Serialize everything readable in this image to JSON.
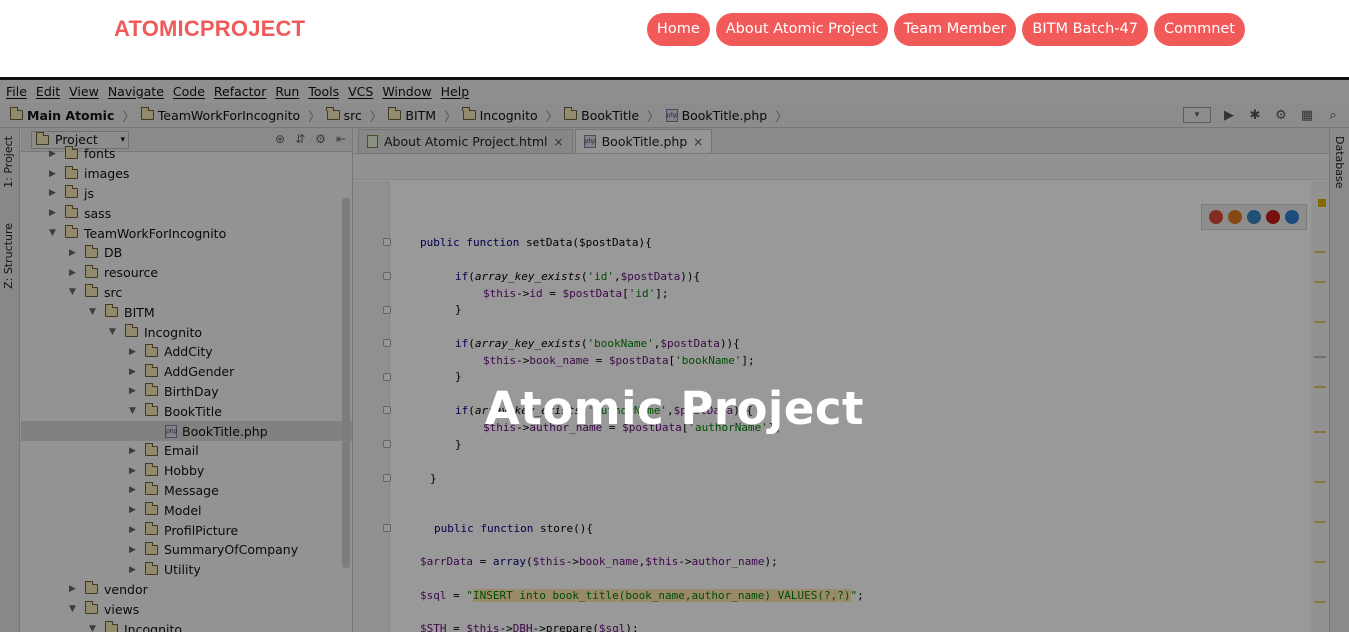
{
  "site": {
    "brand": "ATOMICPROJECT",
    "nav": [
      "Home",
      "About Atomic Project",
      "Team Member",
      "BITM Batch-47",
      "Commnet"
    ],
    "hero_title": "Atomic Project"
  },
  "ide": {
    "menu": [
      "File",
      "Edit",
      "View",
      "Navigate",
      "Code",
      "Refactor",
      "Run",
      "Tools",
      "VCS",
      "Window",
      "Help"
    ],
    "breadcrumbs": [
      "Main Atomic",
      "TeamWorkForIncognito",
      "src",
      "BITM",
      "Incognito",
      "BookTitle",
      "BookTitle.php"
    ],
    "side_tabs": {
      "project": "1: Project",
      "structure": "Z: Structure",
      "database": "Database"
    },
    "project_panel_title": "Project",
    "tree": [
      {
        "label": "fonts",
        "depth": 1,
        "arrow": "right",
        "type": "folder"
      },
      {
        "label": "images",
        "depth": 1,
        "arrow": "right",
        "type": "folder"
      },
      {
        "label": "js",
        "depth": 1,
        "arrow": "right",
        "type": "folder"
      },
      {
        "label": "sass",
        "depth": 1,
        "arrow": "right",
        "type": "folder"
      },
      {
        "label": "TeamWorkForIncognito",
        "depth": 1,
        "arrow": "down",
        "type": "folder"
      },
      {
        "label": "DB",
        "depth": 2,
        "arrow": "right",
        "type": "folder"
      },
      {
        "label": "resource",
        "depth": 2,
        "arrow": "right",
        "type": "folder"
      },
      {
        "label": "src",
        "depth": 2,
        "arrow": "down",
        "type": "folder"
      },
      {
        "label": "BITM",
        "depth": 3,
        "arrow": "down",
        "type": "folder"
      },
      {
        "label": "Incognito",
        "depth": 4,
        "arrow": "down",
        "type": "folder"
      },
      {
        "label": "AddCity",
        "depth": 5,
        "arrow": "right",
        "type": "folder"
      },
      {
        "label": "AddGender",
        "depth": 5,
        "arrow": "right",
        "type": "folder"
      },
      {
        "label": "BirthDay",
        "depth": 5,
        "arrow": "right",
        "type": "folder"
      },
      {
        "label": "BookTitle",
        "depth": 5,
        "arrow": "down",
        "type": "folder"
      },
      {
        "label": "BookTitle.php",
        "depth": 6,
        "arrow": "",
        "type": "php",
        "selected": true
      },
      {
        "label": "Email",
        "depth": 5,
        "arrow": "right",
        "type": "folder"
      },
      {
        "label": "Hobby",
        "depth": 5,
        "arrow": "right",
        "type": "folder"
      },
      {
        "label": "Message",
        "depth": 5,
        "arrow": "right",
        "type": "folder"
      },
      {
        "label": "Model",
        "depth": 5,
        "arrow": "right",
        "type": "folder"
      },
      {
        "label": "ProfilPicture",
        "depth": 5,
        "arrow": "right",
        "type": "folder"
      },
      {
        "label": "SummaryOfCompany",
        "depth": 5,
        "arrow": "right",
        "type": "folder"
      },
      {
        "label": "Utility",
        "depth": 5,
        "arrow": "right",
        "type": "folder"
      },
      {
        "label": "vendor",
        "depth": 2,
        "arrow": "right",
        "type": "folder"
      },
      {
        "label": "views",
        "depth": 2,
        "arrow": "down",
        "type": "folder"
      },
      {
        "label": "Incognito",
        "depth": 3,
        "arrow": "down",
        "type": "folder"
      }
    ],
    "tabs": [
      {
        "label": "About Atomic Project.html",
        "close": "×",
        "active": false
      },
      {
        "label": "BookTitle.php",
        "close": "×",
        "active": true
      }
    ],
    "code": [
      "public function setData($postData){",
      "if(array_key_exists('id',$postData)){",
      "$this->id = $postData['id'];",
      "}",
      "if(array_key_exists('bookName',$postData)){",
      "$this->book_name = $postData['bookName'];",
      "}",
      "if(array_key_exists('authorName',$postData)){",
      "$this->author_name = $postData['authorName'];",
      "}",
      "}",
      "public function store(){",
      "$arrData = array($this->book_name,$this->author_name);",
      "$sql = \"INSERT into book_title(book_name,author_name) VALUES(?,?)\";",
      "$STH = $this->DBH->prepare($sql);"
    ]
  },
  "colors": {
    "brand": "#f05a5a",
    "nav_pill": "#f25a5a",
    "overlay": "rgba(0,0,0,0.40)"
  }
}
